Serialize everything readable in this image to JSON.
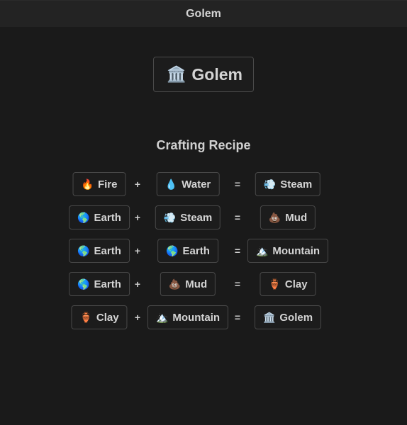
{
  "header": {
    "title": "Golem"
  },
  "result": {
    "icon": "🏛️",
    "icon_name": "classical-building-icon",
    "label": "Golem"
  },
  "section_title": "Crafting Recipe",
  "operators": {
    "plus": "+",
    "equals": "="
  },
  "recipes": [
    {
      "a": {
        "icon": "🔥",
        "icon_name": "fire-icon",
        "label": "Fire"
      },
      "b": {
        "icon": "💧",
        "icon_name": "droplet-icon",
        "label": "Water"
      },
      "result": {
        "icon": "💨",
        "icon_name": "dash-icon",
        "label": "Steam"
      }
    },
    {
      "a": {
        "icon": "🌎",
        "icon_name": "globe-icon",
        "label": "Earth"
      },
      "b": {
        "icon": "💨",
        "icon_name": "dash-icon",
        "label": "Steam"
      },
      "result": {
        "icon": "💩",
        "icon_name": "poop-icon",
        "label": "Mud"
      }
    },
    {
      "a": {
        "icon": "🌎",
        "icon_name": "globe-icon",
        "label": "Earth"
      },
      "b": {
        "icon": "🌎",
        "icon_name": "globe-icon",
        "label": "Earth"
      },
      "result": {
        "icon": "🏔️",
        "icon_name": "mountain-icon",
        "label": "Mountain"
      }
    },
    {
      "a": {
        "icon": "🌎",
        "icon_name": "globe-icon",
        "label": "Earth"
      },
      "b": {
        "icon": "💩",
        "icon_name": "poop-icon",
        "label": "Mud"
      },
      "result": {
        "icon": "🏺",
        "icon_name": "amphora-icon",
        "label": "Clay"
      }
    },
    {
      "a": {
        "icon": "🏺",
        "icon_name": "amphora-icon",
        "label": "Clay"
      },
      "b": {
        "icon": "🏔️",
        "icon_name": "mountain-icon",
        "label": "Mountain"
      },
      "result": {
        "icon": "🏛️",
        "icon_name": "classical-building-icon",
        "label": "Golem"
      }
    }
  ]
}
